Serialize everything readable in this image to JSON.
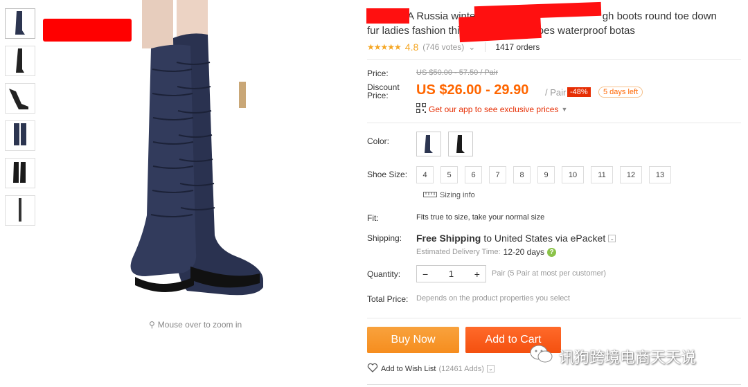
{
  "product": {
    "title_visible_1": "A Russia winter",
    "title_visible_2": "gh boots round toe down",
    "title_line2_a": "fur ladies fashion thigh",
    "title_line2_b": "hoes waterproof botas",
    "rating": "4.8",
    "votes": "(746 votes)",
    "orders": "1417 orders"
  },
  "price": {
    "price_label": "Price:",
    "original": "US $50.00 - 57.50 / Pair",
    "discount_label_1": "Discount",
    "discount_label_2": "Price:",
    "discounted": "US $26.00 - 29.90",
    "unit": "/ Pair",
    "discount_badge": "-48%",
    "days_left": "5 days left",
    "app_link": "Get our app to see exclusive prices"
  },
  "options": {
    "color_label": "Color:",
    "size_label": "Shoe Size:",
    "sizes": [
      "4",
      "5",
      "6",
      "7",
      "8",
      "9",
      "10",
      "11",
      "12",
      "13"
    ],
    "sizing_info": "Sizing info",
    "fit_label": "Fit:",
    "fit_text": "Fits true to size, take your normal size"
  },
  "shipping": {
    "label": "Shipping:",
    "free": "Free Shipping",
    "to": "to United States via ePacket",
    "est_label": "Estimated Delivery Time:",
    "days": "12-20 days"
  },
  "quantity": {
    "label": "Quantity:",
    "value": "1",
    "minus": "−",
    "plus": "+",
    "note": "Pair (5 Pair at most per customer)"
  },
  "total": {
    "label": "Total Price:",
    "note": "Depends on the product properties you select"
  },
  "actions": {
    "buy_now": "Buy Now",
    "add_to_cart": "Add to Cart",
    "wish_list": "Add to Wish List",
    "wish_count": "(12461 Adds)"
  },
  "gallery": {
    "zoom_hint": "Mouse over to zoom in"
  },
  "watermark": {
    "text": "讯狗跨境电商天天说"
  },
  "colors": {
    "accent_orange": "#f60",
    "badge_red": "#e62e04",
    "boot_navy": "#2c3550"
  }
}
